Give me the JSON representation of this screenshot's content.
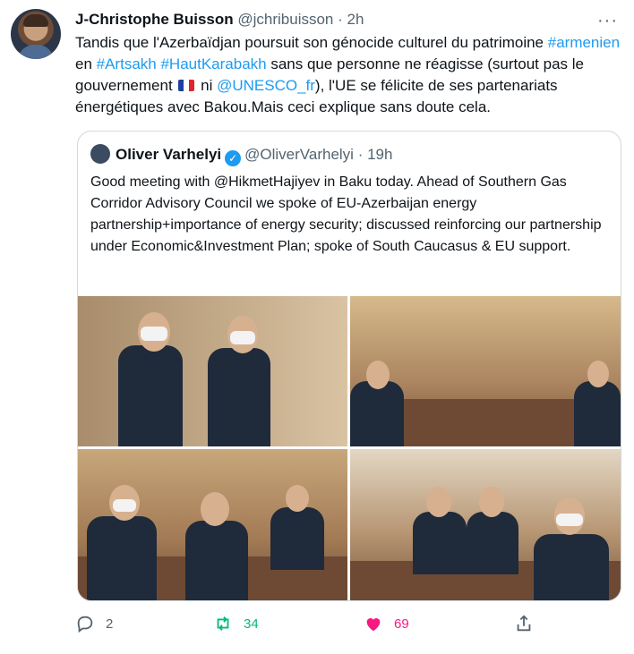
{
  "author": {
    "name": "J-Christophe Buisson",
    "handle": "@jchribuisson",
    "time": "· 2h"
  },
  "tweet_text": {
    "p1": "Tandis que l'Azerbaïdjan poursuit son génocide culturel du patrimoine ",
    "tag1": "#armenien",
    "p2": " en ",
    "tag2": "#Artsakh",
    "p3": " ",
    "tag3": "#HautKarabakh",
    "p4": " sans que personne ne réagisse (surtout pas le gouvernement ",
    "p5": " ni ",
    "mention": "@UNESCO_fr",
    "p6": "), l'UE se félicite de ses partenariats énergétiques avec Bakou.Mais ceci explique sans doute cela."
  },
  "quote": {
    "name": "Oliver Varhelyi",
    "handle": "@OliverVarhelyi",
    "time": "· 19h",
    "text": "Good meeting with @HikmetHajiyev in Baku today. Ahead of Southern Gas Corridor Advisory Council we spoke of EU-Azerbaijan energy partnership+importance of energy security; discussed reinforcing our partnership under Economic&Investment Plan; spoke of South Caucasus & EU support."
  },
  "actions": {
    "replies": "2",
    "retweets": "34",
    "likes": "69"
  },
  "icons": {
    "more": "more-icon",
    "reply": "reply-icon",
    "retweet": "retweet-icon",
    "like": "like-icon",
    "share": "share-icon",
    "verified": "verified-icon",
    "flag": "france-flag-icon"
  },
  "colors": {
    "link": "#1d9bf0",
    "retweet": "#00ba7c",
    "like": "#f91880"
  }
}
